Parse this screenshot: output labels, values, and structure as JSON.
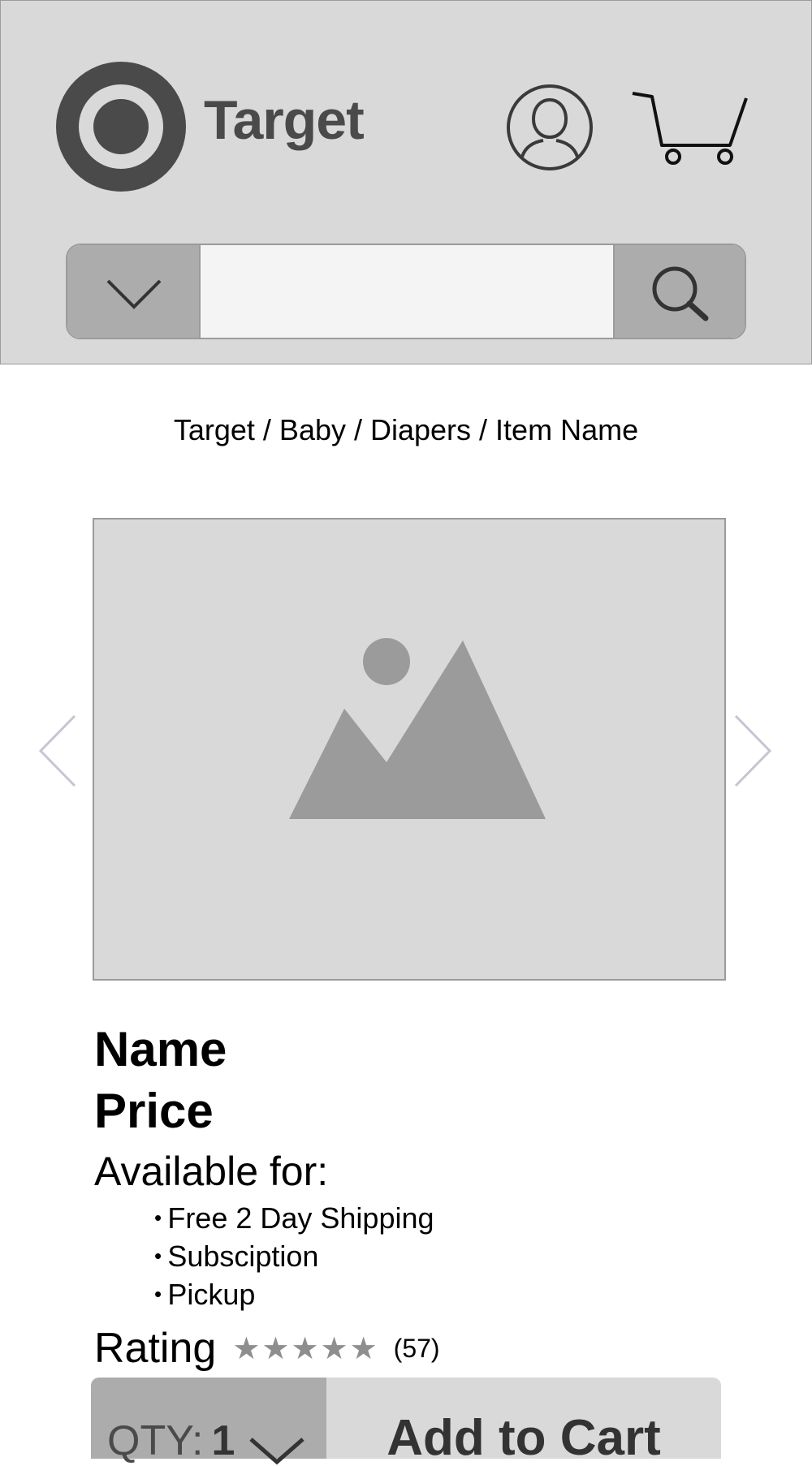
{
  "header": {
    "logo_text": "Target",
    "search": {
      "value": "",
      "placeholder": ""
    }
  },
  "breadcrumb": "Target / Baby / Diapers / Item Name",
  "product": {
    "name": "Name",
    "price": "Price",
    "available_label": "Available for:",
    "available_options": [
      "Free 2 Day Shipping",
      "Subsciption",
      "Pickup"
    ],
    "rating_label": "Rating",
    "stars": "★★★★★",
    "rating_count": "(57)"
  },
  "purchase": {
    "qty_label": "QTY:",
    "qty_value": "1",
    "add_to_cart_label": "Add to Cart"
  },
  "colors": {
    "header_bg": "#d9d9d9",
    "logo": "#4a4a4a",
    "button_gray": "#acacac",
    "star": "#8e8e8e",
    "arrow": "#c4c6d3"
  }
}
